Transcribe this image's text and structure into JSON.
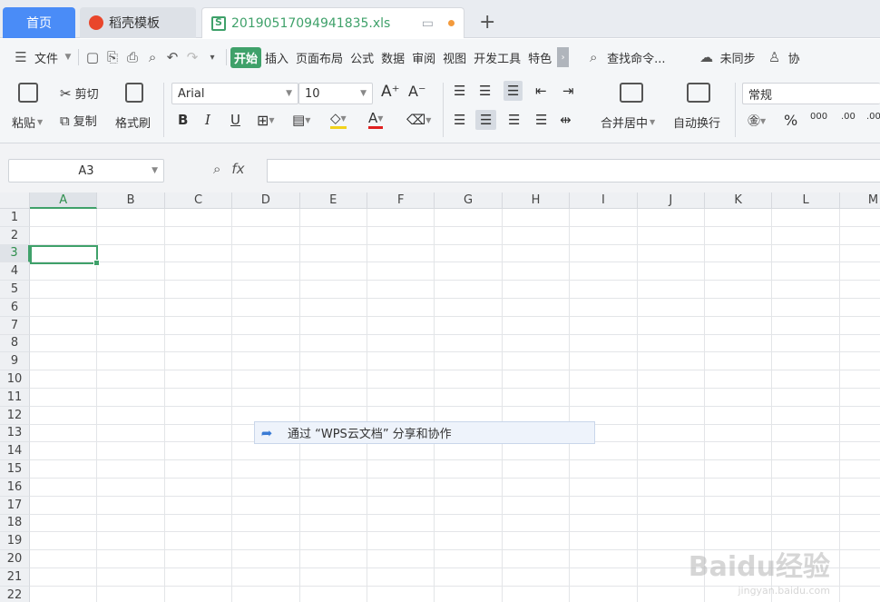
{
  "tabs": {
    "home": "首页",
    "template": "稻壳模板",
    "file": "20190517094941835.xls",
    "new_tab": "+"
  },
  "menu": {
    "file": "文件",
    "items": [
      "开始",
      "插入",
      "页面布局",
      "公式",
      "数据",
      "审阅",
      "视图",
      "开发工具",
      "特色"
    ],
    "search": "查找命令...",
    "sync": "未同步",
    "collab": "协"
  },
  "ribbon": {
    "paste": "粘贴",
    "cut": "剪切",
    "copy": "复制",
    "format_painter": "格式刷",
    "font": "Arial",
    "font_size": "10",
    "increase_font": "A⁺",
    "decrease_font": "A⁻",
    "bold": "B",
    "italic": "I",
    "underline": "U",
    "merge_center": "合并居中",
    "wrap_text": "自动换行",
    "number_format": "常规",
    "percent": "%",
    "thousands": "000",
    "inc_decimal": ".00",
    "dec_decimal": ".00"
  },
  "formula_bar": {
    "cell_ref": "A3",
    "fx": "fx",
    "value": ""
  },
  "grid": {
    "columns": [
      "A",
      "B",
      "C",
      "D",
      "E",
      "F",
      "G",
      "H",
      "I",
      "J",
      "K",
      "L",
      "M"
    ],
    "rows": [
      "1",
      "2",
      "3",
      "4",
      "5",
      "6",
      "7",
      "8",
      "9",
      "10",
      "11",
      "12",
      "13",
      "14",
      "15",
      "16",
      "17",
      "18",
      "19",
      "20",
      "21",
      "22"
    ],
    "selected_column": "A",
    "selected_row": "3"
  },
  "share_banner": {
    "text": "通过 “WPS云文档” 分享和协作"
  },
  "watermark": {
    "line1": "Baidu经验",
    "line2": "jingyan.baidu.com"
  },
  "colors": {
    "accent_green": "#3fa16a",
    "home_tab_blue": "#4a8cf7"
  }
}
